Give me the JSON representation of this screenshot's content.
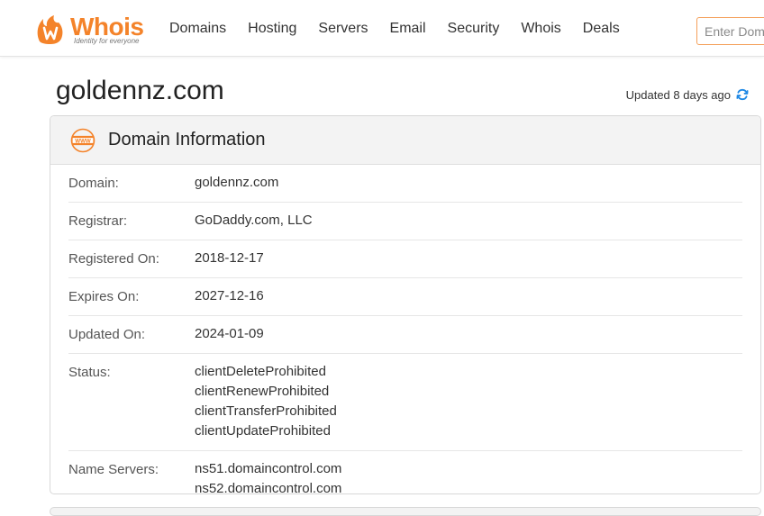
{
  "header": {
    "logo": {
      "name": "Whois",
      "tagline": "Identity for everyone",
      "icon": "flame-w-icon",
      "brand_color": "#f4832a"
    },
    "nav": [
      {
        "label": "Domains"
      },
      {
        "label": "Hosting"
      },
      {
        "label": "Servers"
      },
      {
        "label": "Email"
      },
      {
        "label": "Security"
      },
      {
        "label": "Whois"
      },
      {
        "label": "Deals"
      }
    ],
    "search": {
      "placeholder": "Enter Domain",
      "value": ""
    }
  },
  "page": {
    "domain": "goldennz.com",
    "updated": "Updated 8 days ago",
    "refresh_icon": "refresh-icon",
    "accent_color": "#1e88e5"
  },
  "domain_info": {
    "title": "Domain Information",
    "icon": "www-icon",
    "rows": [
      {
        "label": "Domain:",
        "values": [
          "goldennz.com"
        ]
      },
      {
        "label": "Registrar:",
        "values": [
          "GoDaddy.com, LLC"
        ]
      },
      {
        "label": "Registered On:",
        "values": [
          "2018-12-17"
        ]
      },
      {
        "label": "Expires On:",
        "values": [
          "2027-12-16"
        ]
      },
      {
        "label": "Updated On:",
        "values": [
          "2024-01-09"
        ]
      },
      {
        "label": "Status:",
        "values": [
          "clientDeleteProhibited",
          "clientRenewProhibited",
          "clientTransferProhibited",
          "clientUpdateProhibited"
        ]
      },
      {
        "label": "Name Servers:",
        "values": [
          "ns51.domaincontrol.com",
          "ns52.domaincontrol.com"
        ]
      }
    ]
  }
}
